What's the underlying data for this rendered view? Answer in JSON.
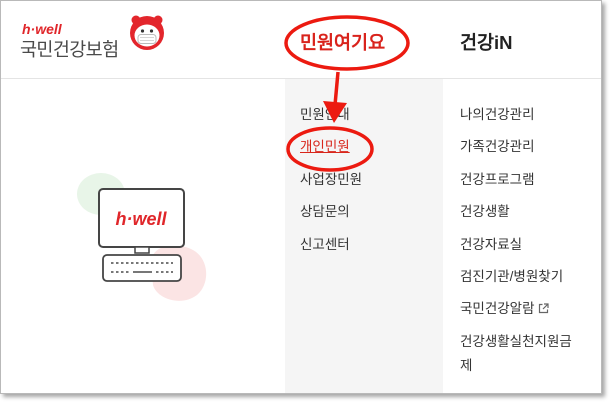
{
  "header": {
    "logo": {
      "brand": "h·well",
      "name": "국민건강보험",
      "mascot_icon": "mascot-icon"
    },
    "nav": [
      {
        "label": "민원여기요"
      },
      {
        "label": "건강iN"
      }
    ]
  },
  "menus": {
    "civil": {
      "items": [
        {
          "label": "민원안내"
        },
        {
          "label": "개인민원"
        },
        {
          "label": "사업장민원"
        },
        {
          "label": "상담문의"
        },
        {
          "label": "신고센터"
        }
      ]
    },
    "health": {
      "items": [
        {
          "label": "나의건강관리"
        },
        {
          "label": "가족건강관리"
        },
        {
          "label": "건강프로그램"
        },
        {
          "label": "건강생활"
        },
        {
          "label": "건강자료실"
        },
        {
          "label": "검진기관/병원찾기"
        },
        {
          "label": "국민건강알람",
          "icon": "external-link-icon"
        },
        {
          "label": "건강생활실천지원금제"
        }
      ]
    }
  },
  "illustration": {
    "icon": "computer-illustration",
    "screen_brand": "h·well"
  },
  "colors": {
    "brand_red": "#e0262a",
    "active_link": "#d8261b",
    "annotation_red": "#ec1a10",
    "menu_background": "#f5f5f5",
    "text": "#333333"
  }
}
